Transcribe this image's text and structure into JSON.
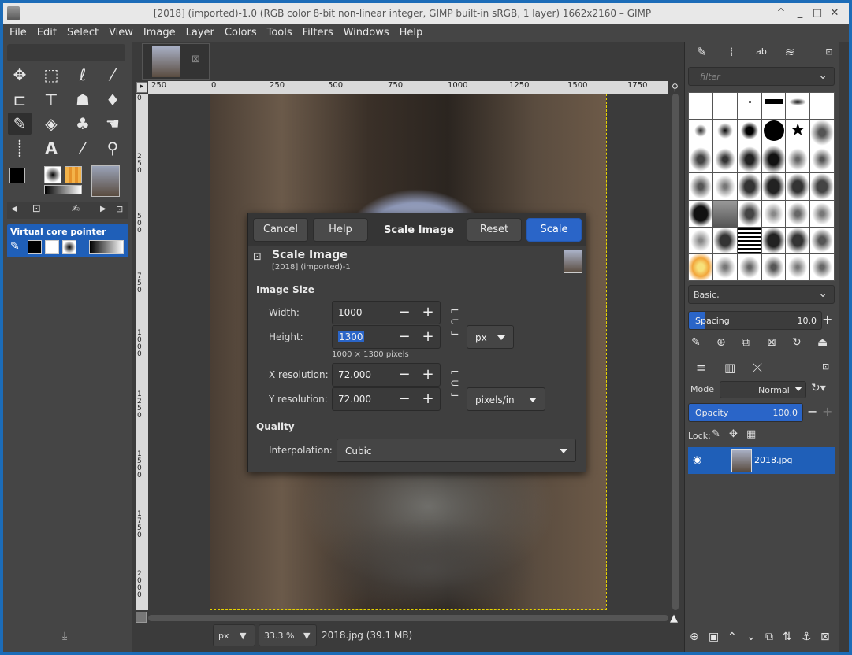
{
  "window": {
    "title": "[2018] (imported)-1.0 (RGB color 8-bit non-linear integer, GIMP built-in sRGB, 1 layer) 1662x2160 – GIMP",
    "controls": [
      "^",
      "_",
      "□",
      "✕"
    ]
  },
  "menu": [
    "File",
    "Edit",
    "Select",
    "View",
    "Image",
    "Layer",
    "Colors",
    "Tools",
    "Filters",
    "Windows",
    "Help"
  ],
  "toolbox": {
    "device_status": "Virtual core pointer"
  },
  "ruler": {
    "h_ticks": [
      "250",
      "0",
      "250",
      "500",
      "750",
      "1000",
      "1250",
      "1500",
      "1750"
    ],
    "v_ticks": [
      "0",
      "2 5 0",
      "5 0 0",
      "7 5 0",
      "1 0 0 0",
      "1 2 5 0",
      "1 5 0 0",
      "1 7 5 0",
      "2 0 0 0"
    ]
  },
  "status": {
    "unit": "px",
    "zoom": "33.3 %",
    "file": "2018.jpg (39.1 MB)"
  },
  "brushes": {
    "filter_placeholder": "filter",
    "preset": "Basic,",
    "spacing_label": "Spacing",
    "spacing_value": "10.0",
    "spacing_fraction": 0.1
  },
  "layers": {
    "mode_label": "Mode",
    "mode_value": "Normal",
    "opacity_label": "Opacity",
    "opacity_value": "100.0",
    "opacity_fraction": 1.0,
    "lock_label": "Lock:",
    "layer_name": "2018.jpg"
  },
  "dialog": {
    "cancel": "Cancel",
    "help": "Help",
    "heading": "Scale Image",
    "reset": "Reset",
    "scale": "Scale",
    "title": "Scale Image",
    "subtitle": "[2018] (imported)-1",
    "image_size_label": "Image Size",
    "width_label": "Width:",
    "width_value": "1000",
    "height_label": "Height:",
    "height_value": "1300",
    "size_unit": "px",
    "pixels_summary": "1000 × 1300 pixels",
    "xres_label": "X resolution:",
    "xres_value": "72.000",
    "yres_label": "Y resolution:",
    "yres_value": "72.000",
    "res_unit": "pixels/in",
    "quality_label": "Quality",
    "interp_label": "Interpolation:",
    "interp_value": "Cubic",
    "minus": "−",
    "plus": "+"
  }
}
